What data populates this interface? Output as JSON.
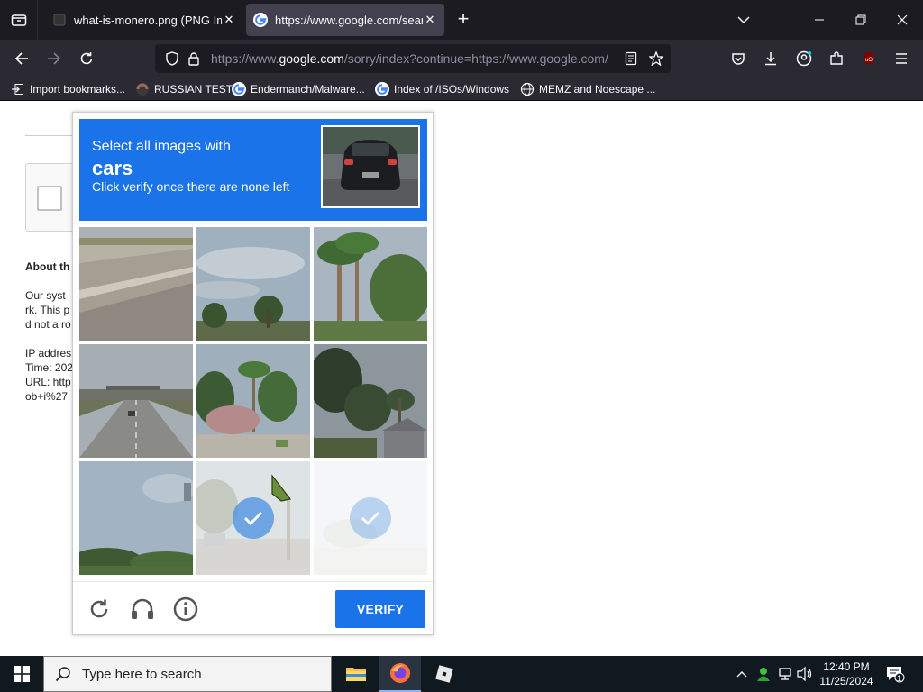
{
  "browser": {
    "tabs": [
      {
        "title": "what-is-monero.png (PNG Ima",
        "favicon": "image-icon",
        "active": false
      },
      {
        "title": "https://www.google.com/searc",
        "favicon": "google-icon",
        "active": true
      }
    ],
    "url_prefix": "https://www.",
    "url_host": "google.com",
    "url_rest": "/sorry/index?continue=https://www.google.com/",
    "bookmarks": [
      {
        "label": "Import bookmarks...",
        "icon": "import-icon"
      },
      {
        "label": "RUSSIAN TEST",
        "icon": "bookmark-favicon"
      },
      {
        "label": "Endermanch/Malware...",
        "icon": "google-icon"
      },
      {
        "label": "Index of /ISOs/Windows",
        "icon": "google-icon"
      },
      {
        "label": "MEMZ and Noescape ...",
        "icon": "globe-icon"
      }
    ]
  },
  "page": {
    "about_heading": "About th",
    "para_lines": [
      "Our syst",
      "rk. This p",
      "d not a ro"
    ],
    "ip_lines": [
      "IP addres",
      "Time: 202",
      "URL: http",
      "ob+i%27"
    ]
  },
  "captcha": {
    "instruction_line1": "Select all images with",
    "keyword": "cars",
    "instruction_line3": "Click verify once there are none left",
    "verify_label": "VERIFY",
    "tiles_selected": [
      false,
      false,
      false,
      false,
      false,
      false,
      false,
      true,
      true
    ]
  },
  "taskbar": {
    "search_placeholder": "Type here to search",
    "time": "12:40 PM",
    "date": "11/25/2024",
    "notification_count": "1"
  },
  "colors": {
    "captcha_blue": "#1a73e8",
    "browser_dark": "#1c1b22",
    "toolbar": "#2b2a33"
  }
}
